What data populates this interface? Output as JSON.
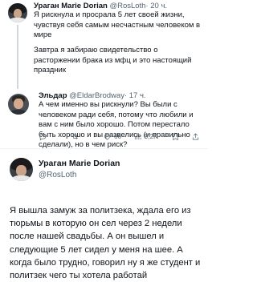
{
  "tweet1": {
    "name": "Ураган Marie Dorian",
    "handle": "@RosLoth",
    "time": "· 20 ч.",
    "para1": "Я рискнула и просрала 5 лет своей жизни, чувствуя себя самым несчастным человеком в мире",
    "para2": "Завтра я забираю свидетельство о расторжении брака из мфц и это настоящий праздник"
  },
  "reply": {
    "name": "Эльдар",
    "handle": "@EldarBrodway",
    "time": "· 17 ч.",
    "text": "А чем именно вы рискнули? Вы были с человеком ради себя, потому что любили и вам с ним было хорошо. Потом перестало быть хорошо и вы развелись (и правильно сделали), но в чем риск?",
    "actions": {
      "replies": "",
      "retweets": "",
      "likes": "66",
      "views": "9,2K",
      "bookmarks": ""
    }
  },
  "main_tweet": {
    "name": "Ураган Marie Dorian",
    "handle": "@RosLoth",
    "text": "Я вышла замуж за политзека, ждала его из тюрьмы в которую он сел через 2 недели после нашей свадьбы. А он вышел и следующие 5 лет сидел у меня на шее. А когда было трудно, говорил ну я же студент и политзек чего ты хотела работай"
  },
  "icons": {
    "reply": "reply-icon",
    "retweet": "retweet-icon",
    "like": "heart-icon",
    "views": "views-icon",
    "bookmark": "bookmark-icon",
    "share": "share-icon"
  }
}
